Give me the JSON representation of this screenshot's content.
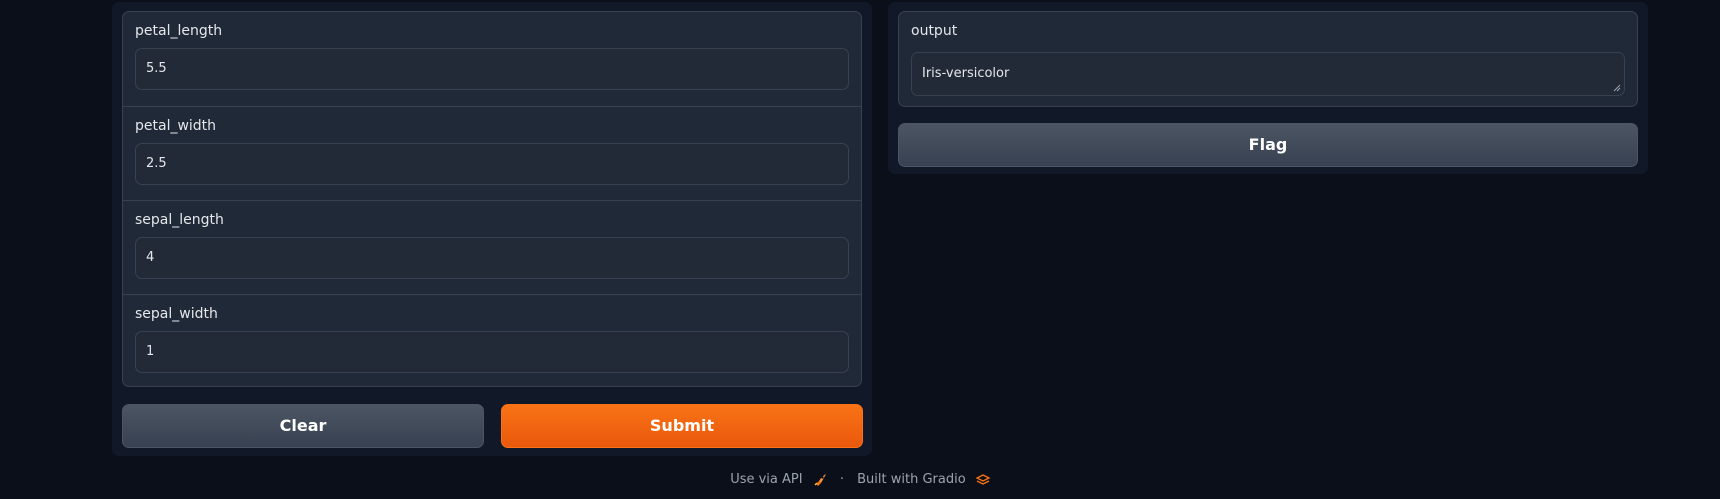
{
  "inputs": [
    {
      "label": "petal_length",
      "value": "5.5"
    },
    {
      "label": "petal_width",
      "value": "2.5"
    },
    {
      "label": "sepal_length",
      "value": "4"
    },
    {
      "label": "sepal_width",
      "value": "1"
    }
  ],
  "buttons": {
    "clear": "Clear",
    "submit": "Submit",
    "flag": "Flag"
  },
  "output": {
    "label": "output",
    "value": "Iris-versicolor"
  },
  "footer": {
    "api_link": "Use via API",
    "separator": "·",
    "built_with": "Built with Gradio"
  },
  "colors": {
    "background": "#0b0f19",
    "panel": "#111827",
    "accent": "#f97316"
  },
  "icons": {
    "api": "rocket-icon",
    "gradio": "gradio-logo-icon"
  }
}
